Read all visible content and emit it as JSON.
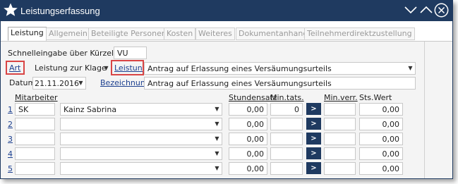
{
  "window": {
    "title": "Leistungserfassung",
    "icons": [
      "star-icon",
      "minimize-chevron-icon",
      "maximize-chevron-icon",
      "close-icon"
    ]
  },
  "tabs": [
    {
      "label": "Leistung",
      "active": true
    },
    {
      "label": "Allgemein",
      "active": false
    },
    {
      "label": "Beteiligte Personen",
      "active": false
    },
    {
      "label": "Kosten",
      "active": false
    },
    {
      "label": "Weiteres",
      "active": false
    },
    {
      "label": "Dokumentanhang",
      "active": false
    },
    {
      "label": "Teilnehmerdirektzustellung",
      "active": false
    }
  ],
  "form": {
    "schnelleingabe_label": "Schnelleingabe über Kürzel:",
    "schnelleingabe_value": "VU",
    "art_label": "Art",
    "art_value": "Leistung zur Klage",
    "leistung_label": "Leistung",
    "leistung_value": "Antrag auf Erlassung eines Versäumungsurteils",
    "datum_label": "Datum",
    "datum_value": "21.11.2016",
    "bezeichnung_label": "Bezeichnung",
    "bezeichnung_value": "Antrag auf Erlassung eines Versäumungsurteils"
  },
  "table": {
    "headers": {
      "mitarbeiter": "Mitarbeiter",
      "stundensatz": "Stundensatz",
      "min_tats": "Min.tats.",
      "min_verr": "Min.verr.",
      "sts_wert": "Sts.Wert"
    },
    "go_label": ">",
    "rows": [
      {
        "num": "1",
        "kuerzel": "SK",
        "name": "Kainz Sabrina",
        "stundensatz": "0,00",
        "min_tats": "0",
        "min_verr": "",
        "sts_wert": "0,00"
      },
      {
        "num": "2",
        "kuerzel": "",
        "name": "",
        "stundensatz": "0,00",
        "min_tats": "",
        "min_verr": "",
        "sts_wert": "0,00"
      },
      {
        "num": "3",
        "kuerzel": "",
        "name": "",
        "stundensatz": "0,00",
        "min_tats": "",
        "min_verr": "",
        "sts_wert": "0,00"
      },
      {
        "num": "4",
        "kuerzel": "",
        "name": "",
        "stundensatz": "0,00",
        "min_tats": "",
        "min_verr": "",
        "sts_wert": "0,00"
      },
      {
        "num": "5",
        "kuerzel": "",
        "name": "",
        "stundensatz": "0,00",
        "min_tats": "",
        "min_verr": "",
        "sts_wert": "0,00"
      }
    ]
  },
  "colors": {
    "titlebar": "#1f3a60",
    "highlight": "#d94545",
    "link": "#1b3f8f"
  }
}
